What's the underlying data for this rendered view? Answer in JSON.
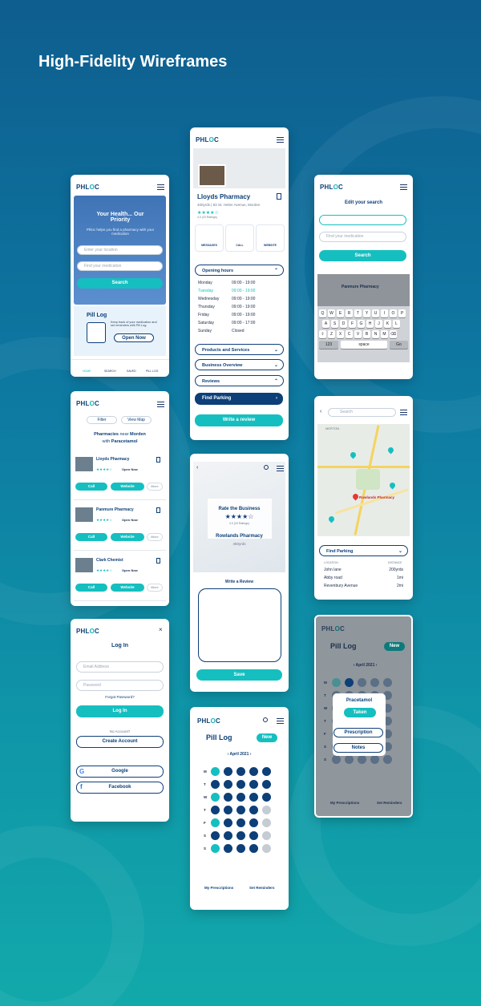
{
  "heading": "High-Fidelity Wireframes",
  "logo": {
    "a": "PHL",
    "b": "O",
    "c": "C"
  },
  "colors": {
    "navy": "#0d3f78",
    "teal": "#15bfc0",
    "bg": "#0d76a0"
  },
  "home": {
    "hero_title": "Your Health... Our Priority",
    "hero_sub": "Phloc helps you find a pharmacy with your medication",
    "loc_ph": "Enter your location",
    "med_ph": "Find your medication",
    "search": "Search",
    "pill_title": "Pill Log",
    "pill_text": "Keep track of your medication and set reminders with Pill Log.",
    "open_now": "Open Now",
    "nav": [
      "HOME",
      "SEARCH",
      "SAVED",
      "PILL LOG"
    ]
  },
  "detail": {
    "name": "Lloyds Pharmacy",
    "addr": "400yrds | 83 St. Helier Avenue, Morden",
    "reviews": "4.0 (20 Ratings)",
    "actions": [
      "MESSAGES",
      "CALL",
      "WEBSITE"
    ],
    "hours_label": "Opening hours",
    "hours": [
      [
        "Monday",
        "09:00 - 19:00"
      ],
      [
        "Tuesday",
        "09:00 - 19:00"
      ],
      [
        "Wednesday",
        "09:00 - 19:00"
      ],
      [
        "Thursday",
        "09:00 - 19:00"
      ],
      [
        "Friday",
        "09:00 - 19:00"
      ],
      [
        "Saturday",
        "09:00 - 17:00"
      ],
      [
        "Sunday",
        "Closed"
      ]
    ],
    "sections": [
      "Products and Services",
      "Business Overview",
      "Reviews"
    ],
    "find_parking": "Find Parking",
    "write_review": "Write a review"
  },
  "edit": {
    "title": "Edit your search",
    "search": "Search",
    "pharm": "Panmure Pharmacy",
    "rows": [
      [
        "Q",
        "W",
        "E",
        "R",
        "T",
        "Y",
        "U",
        "I",
        "O",
        "P"
      ],
      [
        "A",
        "S",
        "D",
        "F",
        "G",
        "H",
        "J",
        "K",
        "L"
      ],
      [
        "⇧",
        "Z",
        "X",
        "C",
        "V",
        "B",
        "N",
        "M",
        "⌫"
      ]
    ],
    "k123": "123",
    "space": "space",
    "go": "Go"
  },
  "results": {
    "filter": "Filter",
    "view_map": "View Map",
    "heading_a": "Pharmacies",
    "heading_b": "near",
    "heading_c": "Morden",
    "heading_d": "with",
    "heading_e": "Paracetamol",
    "items": [
      {
        "name": "Lloyds Pharmacy",
        "status": "Open Now"
      },
      {
        "name": "Panmure Pharmacy",
        "status": "Open Now"
      },
      {
        "name": "Clark Chemist",
        "status": "Open Now"
      }
    ],
    "call": "Call",
    "website": "Website",
    "more": "More"
  },
  "rate": {
    "title": "Rate the Business",
    "sub": "4.0 (20 Ratings)",
    "pharm": "Rowlands Pharmacy",
    "dist": "450yrds",
    "write": "Write a Review",
    "save": "Save"
  },
  "map": {
    "search_ph": "Search",
    "area": "MERTON",
    "place": "Rowlands Pharmacy",
    "find_parking": "Find Parking",
    "loc_h": "LOCATION",
    "dist_h": "DISTANCE",
    "rows": [
      [
        "John lane",
        "200yrds"
      ],
      [
        "Abby road",
        "1mi"
      ],
      [
        "Revenbury Avenue",
        "2mi"
      ]
    ]
  },
  "login": {
    "title": "Log In",
    "email": "Email Address",
    "password": "Password",
    "forgot": "Forgot Password?",
    "login": "Log In",
    "no_acc": "No Account?",
    "create": "Create Account",
    "google": "Google",
    "facebook": "Facebook"
  },
  "pill": {
    "title": "Pill Log",
    "new": "New",
    "month": "April 2021",
    "days": [
      "M",
      "T",
      "W",
      "T",
      "F",
      "S",
      "S"
    ],
    "presc": "My Prescriptions",
    "remind": "Set Reminders"
  },
  "popup": {
    "med": "Pracetamol",
    "taken": "Taken",
    "prescription": "Prescription",
    "notes": "Notes"
  }
}
